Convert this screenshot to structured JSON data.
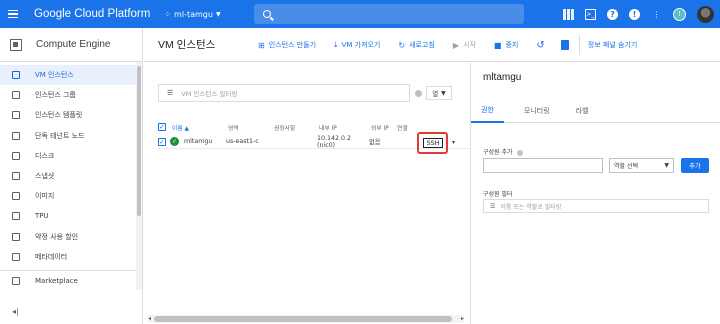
{
  "topbar": {
    "brand": "Google Cloud Platform",
    "project": "ml-tamgu",
    "avatar_letter": "!"
  },
  "sidebar": {
    "title": "Compute Engine",
    "items": [
      {
        "label": "VM 인스턴스",
        "icon": "vm-icon",
        "active": true
      },
      {
        "label": "인스턴스 그룹",
        "icon": "group-icon"
      },
      {
        "label": "인스턴스 템플릿",
        "icon": "template-icon"
      },
      {
        "label": "단독 테넌트 노드",
        "icon": "node-icon"
      },
      {
        "label": "디스크",
        "icon": "disk-icon"
      },
      {
        "label": "스냅샷",
        "icon": "snapshot-icon"
      },
      {
        "label": "이미지",
        "icon": "image-icon"
      },
      {
        "label": "TPU",
        "icon": "tpu-icon"
      },
      {
        "label": "약정 사용 할인",
        "icon": "discount-icon"
      },
      {
        "label": "메타데이터",
        "icon": "metadata-icon"
      }
    ],
    "marketplace": "Marketplace",
    "collapse": "◂|"
  },
  "header": {
    "title": "VM 인스턴스",
    "actions": {
      "create": "인스턴스 만들기",
      "import": "VM 가져오기",
      "refresh": "새로고침",
      "start": "시작",
      "stop": "중지"
    },
    "hide_panel": "정보 패널 숨기기"
  },
  "filter": {
    "placeholder": "VM 인스턴스 필터링",
    "columns_label": "열"
  },
  "table": {
    "headers": [
      "이름",
      "영역",
      "권장사항",
      "내부 IP",
      "외부 IP",
      "연결"
    ],
    "rows": [
      {
        "name": "mltamgu",
        "zone": "us-east1-c",
        "recommendation": "",
        "internal_ip": "10.142.0.2 (nic0)",
        "external_ip": "없음",
        "connect": "SSH"
      }
    ]
  },
  "panel": {
    "title": "mltamgu",
    "tabs": [
      "권한",
      "모니터링",
      "라벨"
    ],
    "add_member_label": "구성원 추가",
    "role_select": "역할 선택",
    "add_button": "추가",
    "members_label": "구성원 필터",
    "members_filter_placeholder": "이름 또는 역할로 필터링"
  },
  "colors": {
    "brand_blue": "#1a73e8",
    "highlight_red": "#e53935",
    "status_green": "#1e8e3e"
  }
}
